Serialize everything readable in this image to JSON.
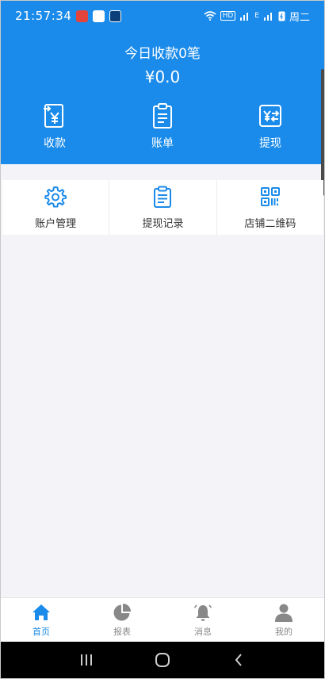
{
  "status_bar": {
    "time": "21:57:34",
    "day": "周二",
    "network_label": "HD",
    "network_type": "E"
  },
  "summary": {
    "title": "今日收款0笔",
    "amount": "¥0.0"
  },
  "top_actions": [
    {
      "label": "收款",
      "icon": "receive-icon"
    },
    {
      "label": "账单",
      "icon": "bill-icon"
    },
    {
      "label": "提现",
      "icon": "withdraw-icon"
    }
  ],
  "menu": [
    {
      "label": "账户管理",
      "icon": "gear-icon"
    },
    {
      "label": "提现记录",
      "icon": "clipboard-icon"
    },
    {
      "label": "店铺二维码",
      "icon": "qrcode-icon"
    }
  ],
  "tabs": [
    {
      "label": "首页",
      "icon": "home-icon",
      "active": true
    },
    {
      "label": "报表",
      "icon": "pie-chart-icon",
      "active": false
    },
    {
      "label": "消息",
      "icon": "bell-icon",
      "active": false
    },
    {
      "label": "我的",
      "icon": "person-icon",
      "active": false
    }
  ],
  "colors": {
    "primary": "#1a8bea",
    "background": "#f3f3f8",
    "tab_inactive": "#888888"
  }
}
